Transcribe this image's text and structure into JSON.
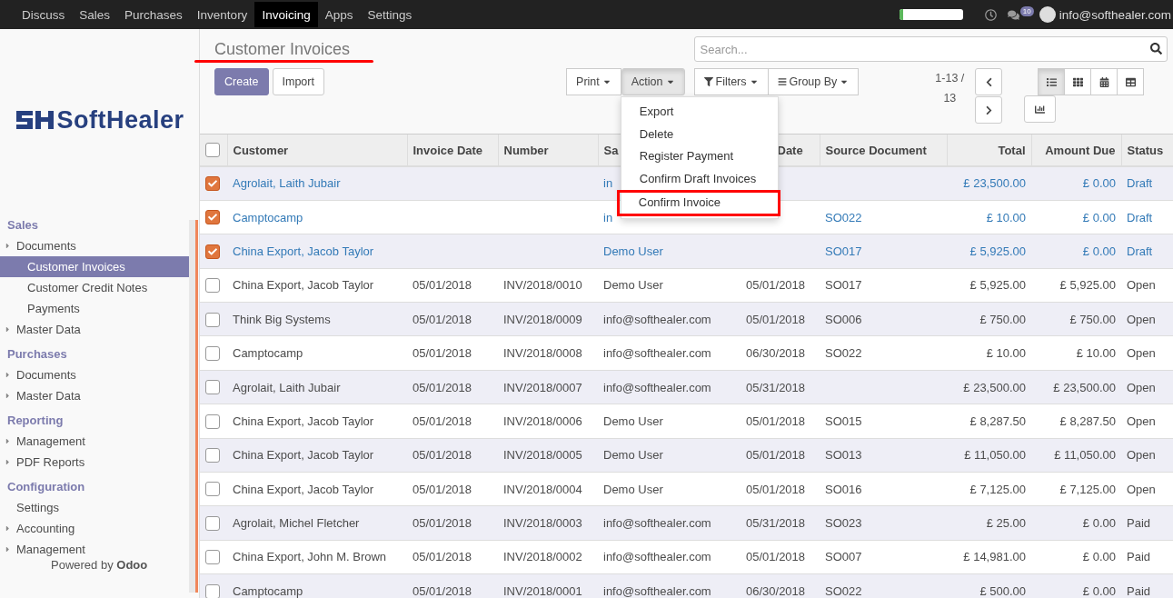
{
  "navbar": {
    "apps": [
      {
        "label": "Discuss",
        "selected": false
      },
      {
        "label": "Sales",
        "selected": false
      },
      {
        "label": "Purchases",
        "selected": false
      },
      {
        "label": "Inventory",
        "selected": false
      },
      {
        "label": "Invoicing",
        "selected": true
      },
      {
        "label": "Apps",
        "selected": false
      },
      {
        "label": "Settings",
        "selected": false
      }
    ],
    "progress": {
      "level": 0.06
    },
    "chat_badge": "10",
    "user": "info@softhealer.com"
  },
  "sidebar": {
    "logo": "SoftHealer",
    "sections": [
      {
        "title": "Sales",
        "items": [
          {
            "label": "Documents",
            "arrow": true,
            "selected": false,
            "children": [
              {
                "label": "Customer Invoices",
                "arrow": false,
                "selected": true
              },
              {
                "label": "Customer Credit Notes",
                "arrow": false,
                "selected": false
              },
              {
                "label": "Payments",
                "arrow": false,
                "selected": false
              }
            ]
          },
          {
            "label": "Master Data",
            "arrow": true,
            "selected": false
          }
        ]
      },
      {
        "title": "Purchases",
        "items": [
          {
            "label": "Documents",
            "arrow": true,
            "selected": false
          },
          {
            "label": "Master Data",
            "arrow": true,
            "selected": false
          }
        ]
      },
      {
        "title": "Reporting",
        "items": [
          {
            "label": "Management",
            "arrow": true,
            "selected": false
          },
          {
            "label": "PDF Reports",
            "arrow": true,
            "selected": false
          }
        ]
      },
      {
        "title": "Configuration",
        "items": [
          {
            "label": "Settings",
            "arrow": false,
            "selected": false
          },
          {
            "label": "Accounting",
            "arrow": true,
            "selected": false
          },
          {
            "label": "Management",
            "arrow": true,
            "selected": false
          }
        ]
      }
    ],
    "footer": "Powered by **Odoo**"
  },
  "control_panel": {
    "title": "Customer Invoices",
    "create": "Create",
    "import": "Import",
    "print": "Print",
    "action": "Action",
    "action_menu": [
      {
        "label": "Export",
        "highlighted": false
      },
      {
        "label": "Delete",
        "highlighted": false
      },
      {
        "label": "Register Payment",
        "highlighted": false
      },
      {
        "label": "Confirm Draft Invoices",
        "highlighted": false
      },
      {
        "label": "Confirm Invoice",
        "highlighted": true
      }
    ],
    "search": {
      "placeholder": "Search..."
    },
    "filters": "Filters",
    "group_by": "Group By",
    "pager": "1-13 / 13",
    "views": [
      {
        "kind": "list",
        "selected": true
      },
      {
        "kind": "kanban",
        "selected": false
      },
      {
        "kind": "calendar",
        "selected": false
      },
      {
        "kind": "pivot",
        "selected": false
      },
      {
        "kind": "graph",
        "selected": false
      }
    ]
  },
  "table": {
    "all_selected": false,
    "columns": [
      "Customer",
      "Invoice Date",
      "Number",
      "Sa",
      "Date",
      "Source Document",
      "Total",
      "Amount Due",
      "Status"
    ],
    "rows": [
      {
        "selected": true,
        "kind": "draft",
        "customer": "Agrolait, Laith Jubair",
        "salesperson": "in",
        "total": "£ 23,500.00",
        "amount_due": "£ 0.00",
        "status": "Draft"
      },
      {
        "selected": true,
        "kind": "draft",
        "customer": "Camptocamp",
        "salesperson": "in",
        "source_document": "SO022",
        "total": "£ 10.00",
        "amount_due": "£ 0.00",
        "status": "Draft"
      },
      {
        "selected": true,
        "kind": "draft",
        "customer": "China Export, Jacob Taylor",
        "salesperson": "Demo User",
        "source_document": "SO017",
        "total": "£ 5,925.00",
        "amount_due": "£ 0.00",
        "status": "Draft"
      },
      {
        "selected": false,
        "kind": "open",
        "customer": "China Export, Jacob Taylor",
        "invoice_date": "05/01/2018",
        "number": "INV/2018/0010",
        "salesperson": "Demo User",
        "due_date": "05/01/2018",
        "source_document": "SO017",
        "total": "£ 5,925.00",
        "amount_due": "£ 5,925.00",
        "status": "Open"
      },
      {
        "selected": false,
        "kind": "open",
        "customer": "Think Big Systems",
        "invoice_date": "05/01/2018",
        "number": "INV/2018/0009",
        "salesperson": "info@softhealer.com",
        "due_date": "05/01/2018",
        "source_document": "SO006",
        "total": "£ 750.00",
        "amount_due": "£ 750.00",
        "status": "Open"
      },
      {
        "selected": false,
        "kind": "open",
        "customer": "Camptocamp",
        "invoice_date": "05/01/2018",
        "number": "INV/2018/0008",
        "salesperson": "info@softhealer.com",
        "due_date": "06/30/2018",
        "source_document": "SO022",
        "total": "£ 10.00",
        "amount_due": "£ 10.00",
        "status": "Open"
      },
      {
        "selected": false,
        "kind": "open",
        "customer": "Agrolait, Laith Jubair",
        "invoice_date": "05/01/2018",
        "number": "INV/2018/0007",
        "salesperson": "info@softhealer.com",
        "due_date": "05/31/2018",
        "total": "£ 23,500.00",
        "amount_due": "£ 23,500.00",
        "status": "Open"
      },
      {
        "selected": false,
        "kind": "open",
        "customer": "China Export, Jacob Taylor",
        "invoice_date": "05/01/2018",
        "number": "INV/2018/0006",
        "salesperson": "Demo User",
        "due_date": "05/01/2018",
        "source_document": "SO015",
        "total": "£ 8,287.50",
        "amount_due": "£ 8,287.50",
        "status": "Open"
      },
      {
        "selected": false,
        "kind": "open",
        "customer": "China Export, Jacob Taylor",
        "invoice_date": "05/01/2018",
        "number": "INV/2018/0005",
        "salesperson": "Demo User",
        "due_date": "05/01/2018",
        "source_document": "SO013",
        "total": "£ 11,050.00",
        "amount_due": "£ 11,050.00",
        "status": "Open"
      },
      {
        "selected": false,
        "kind": "open",
        "customer": "China Export, Jacob Taylor",
        "invoice_date": "05/01/2018",
        "number": "INV/2018/0004",
        "salesperson": "Demo User",
        "due_date": "05/01/2018",
        "source_document": "SO016",
        "total": "£ 7,125.00",
        "amount_due": "£ 7,125.00",
        "status": "Open"
      },
      {
        "selected": false,
        "kind": "paid",
        "customer": "Agrolait, Michel Fletcher",
        "invoice_date": "05/01/2018",
        "number": "INV/2018/0003",
        "salesperson": "info@softhealer.com",
        "due_date": "05/31/2018",
        "source_document": "SO023",
        "total": "£ 25.00",
        "amount_due": "£ 0.00",
        "status": "Paid"
      },
      {
        "selected": false,
        "kind": "paid",
        "customer": "China Export, John M. Brown",
        "invoice_date": "05/01/2018",
        "number": "INV/2018/0002",
        "salesperson": "info@softhealer.com",
        "due_date": "05/01/2018",
        "source_document": "SO007",
        "total": "£ 14,981.00",
        "amount_due": "£ 0.00",
        "status": "Paid"
      },
      {
        "selected": false,
        "kind": "paid",
        "customer": "Camptocamp",
        "invoice_date": "05/01/2018",
        "number": "INV/2018/0001",
        "salesperson": "info@softhealer.com",
        "due_date": "06/30/2018",
        "source_document": "SO022",
        "total": "£ 500.00",
        "amount_due": "£ 0.00",
        "status": "Paid"
      }
    ]
  }
}
